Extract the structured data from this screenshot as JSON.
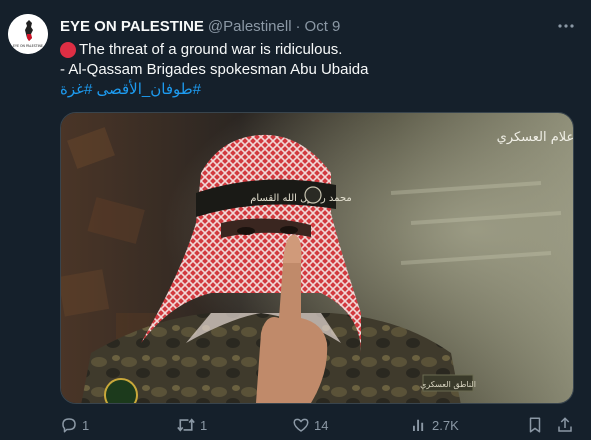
{
  "tweet": {
    "display_name": "EYE ON PALESTINE",
    "handle": "@Palestinell",
    "separator": "·",
    "time": "Oct 9",
    "avatar_label": "EYE ON PALESTINE",
    "text_line1": "The threat of a ground war is ridiculous.",
    "text_line2": "- Al-Qassam Brigades spokesman Abu Ubaida",
    "hashtags": "#طوفان_الأقصى #غزة",
    "media": {
      "watermark": "الإعلام العسكري",
      "headband_text": "محمد رسول الله القسام",
      "name_tag": "الناطق العسكري"
    },
    "actions": {
      "replies": "1",
      "reposts": "1",
      "likes": "14",
      "views": "2.7K"
    }
  },
  "colors": {
    "background": "#15202b",
    "text": "#f7f9f9",
    "muted": "#8b98a5",
    "link": "#1d9bf0",
    "emoji_red": "#dd2e44"
  },
  "icons": [
    "more-icon",
    "red-circle-emoji",
    "reply-icon",
    "repost-icon",
    "like-icon",
    "views-icon",
    "bookmark-icon",
    "share-icon"
  ]
}
